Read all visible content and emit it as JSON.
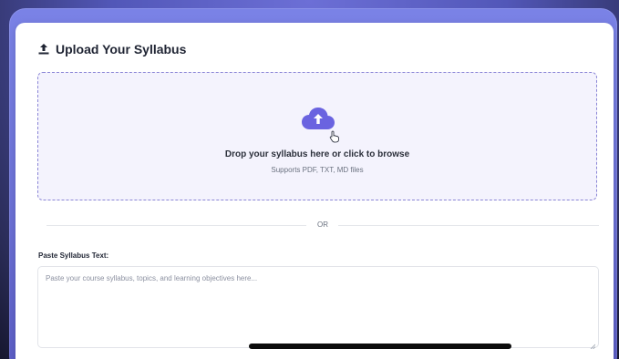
{
  "header": {
    "title": "Upload Your Syllabus",
    "icon": "upload-icon"
  },
  "dropzone": {
    "primary_text": "Drop your syllabus here or click to browse",
    "secondary_text": "Supports PDF, TXT, MD files",
    "icon": "cloud-upload-icon",
    "accent_color": "#6a63e0"
  },
  "divider": {
    "label": "OR"
  },
  "paste": {
    "label": "Paste Syllabus Text:",
    "value": "",
    "placeholder": "Paste your course syllabus, topics, and learning objectives here..."
  }
}
